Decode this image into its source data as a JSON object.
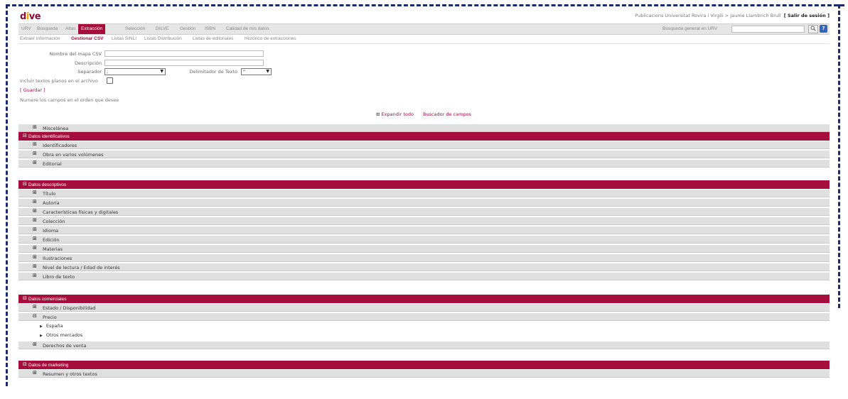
{
  "app": {
    "logo_d": "d",
    "logo_i": "i",
    "logo_v": "v",
    "logo_e": "e",
    "user_text": "Publicacions Universitat Rovira i Virgili > Jaume Llambrich Brull",
    "logout": "[ Salir de sesión ]"
  },
  "menu": {
    "items": [
      "URV",
      "Búsqueda",
      "Altas",
      "Extracción",
      "Selección",
      "DILVE",
      "Gestión",
      "ISBN",
      "Calidad de mis datos"
    ],
    "active": "Extracción",
    "search_label": "Búsqueda general en URV",
    "search_value": "",
    "search_icon": "magnifier-icon",
    "help_icon": "help-icon",
    "help_glyph": "?"
  },
  "submenu": {
    "items": [
      "Extraer información",
      "Gestionar CSV",
      "Listas SINLI",
      "Listas Distribución",
      "Listas de editoriales",
      "Histórico de extracciones"
    ],
    "active": "Gestionar CSV"
  },
  "form": {
    "map_name_label": "Nombre del mapa CSV",
    "description_label": "Descripción",
    "separator_label": "Separador",
    "separator_value": ";",
    "delimiter_label": "Delimitador de Texto",
    "delimiter_value": "\"",
    "include_plain_label": "Incluir textos planos en el archivo",
    "save_link": "[ Guardar ]",
    "instruction": "Numere los campos en el orden que desee",
    "expand_all": "Expandir todo",
    "field_search": "Buscador de campos"
  },
  "sections": {
    "misc": "Miscelánea",
    "ident_header": "Datos identificativos",
    "ident_items": [
      "Identificadores",
      "Obra en varios volúmenes",
      "Editorial"
    ],
    "desc_header": "Datos descriptivos",
    "desc_items": [
      "Título",
      "Autoría",
      "Características físicas y digitales",
      "Colección",
      "Idioma",
      "Edición",
      "Materias",
      "Ilustraciones",
      "Nivel de lectura / Edad de interés",
      "Libro de texto"
    ],
    "comm_header": "Datos comerciales",
    "comm_items": [
      "Estado / Disponibilidad",
      "Precio"
    ],
    "price_sub": [
      "España",
      "Otros mercados"
    ],
    "comm_last": "Derechos de venta",
    "mkt_header": "Datos de marketing",
    "mkt_items": [
      "Resumen y otros textos"
    ]
  },
  "colors": {
    "brand": "#a50d3d",
    "row": "#e0e0e0",
    "border": "#1b2a6b"
  }
}
